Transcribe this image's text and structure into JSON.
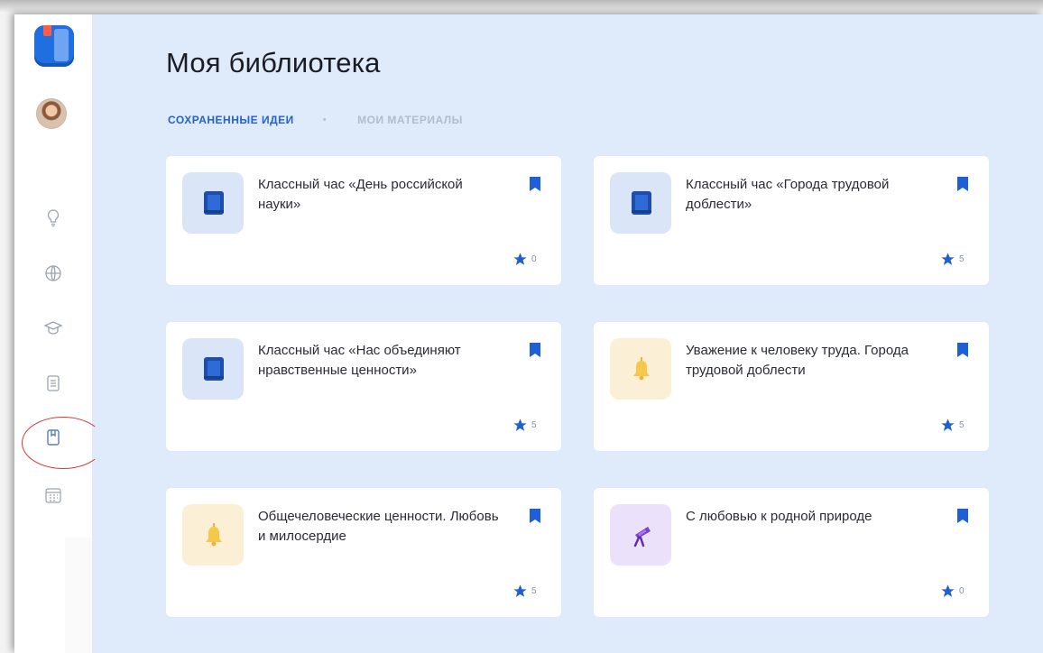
{
  "page": {
    "title": "Моя библиотека"
  },
  "tabs": [
    {
      "label": "СОХРАНЕННЫЕ ИДЕИ",
      "active": true
    },
    {
      "label": "МОИ МАТЕРИАЛЫ",
      "active": false
    }
  ],
  "sidebar": {
    "items": [
      {
        "icon": "lightbulb-icon"
      },
      {
        "icon": "globe-icon"
      },
      {
        "icon": "graduation-cap-icon"
      },
      {
        "icon": "document-icon"
      },
      {
        "icon": "library-book-icon",
        "active": true
      },
      {
        "icon": "calendar-icon"
      }
    ]
  },
  "cards": [
    {
      "title": "Классный час «День российской науки»",
      "rating": "0",
      "icon": "book-icon",
      "theme": "blue"
    },
    {
      "title": "Классный час «Города трудовой доблести»",
      "rating": "5",
      "icon": "book-icon",
      "theme": "blue"
    },
    {
      "title": "Классный час «Нас объединяют нравственные ценности»",
      "rating": "5",
      "icon": "book-icon",
      "theme": "blue"
    },
    {
      "title": "Уважение к человеку труда. Города трудовой доблести",
      "rating": "5",
      "icon": "bell-icon",
      "theme": "yellow"
    },
    {
      "title": "Общечеловеческие ценности. Любовь и милосердие",
      "rating": "5",
      "icon": "bell-icon",
      "theme": "yellow"
    },
    {
      "title": "С любовью к родной природе",
      "rating": "0",
      "icon": "telescope-icon",
      "theme": "purple"
    }
  ],
  "colors": {
    "accent": "#2563c9",
    "background": "#dfeafb",
    "bookmark": "#1f5fd6",
    "annotation": "#d43a3a"
  }
}
